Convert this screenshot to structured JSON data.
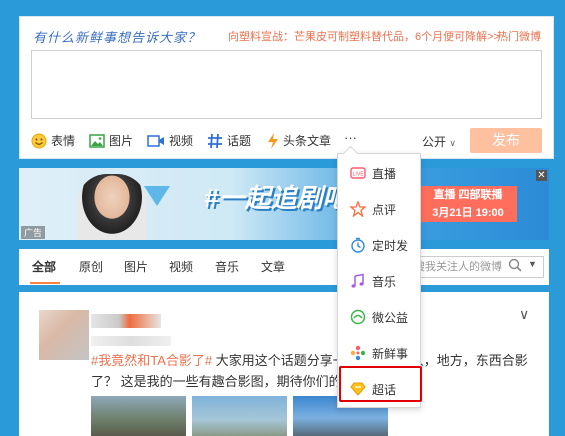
{
  "publisher": {
    "prompt": "有什么新鲜事想告诉大家？",
    "promo": "向塑料宣战：芒果皮可制塑料替代品，6个月便可降解>>",
    "hot_link": "热门微博",
    "textarea_value": "",
    "tools": [
      {
        "icon": "emoji-icon",
        "label": "表情"
      },
      {
        "icon": "image-icon",
        "label": "图片"
      },
      {
        "icon": "video-icon",
        "label": "视频"
      },
      {
        "icon": "hashtag-icon",
        "label": "话题"
      },
      {
        "icon": "lightning-icon",
        "label": "头条文章"
      },
      {
        "icon": "more-icon",
        "label": "···"
      }
    ],
    "visibility": "公开",
    "publish_label": "发布"
  },
  "banner": {
    "ad_label": "广告",
    "close": "✕",
    "slogan": "#一起追剧吧",
    "date_line1": "直播 四部联播",
    "date_line2": "3月21日 19:00"
  },
  "feed_tabs": {
    "tabs": [
      "全部",
      "原创",
      "图片",
      "视频",
      "音乐",
      "文章"
    ],
    "active_index": 0,
    "search_placeholder": "搜我关注人的微博"
  },
  "feed_post": {
    "tag": "#我竟然和TA合影了#",
    "text_line1": " 大家用这个话题分享一下自己和名人，地方，东西合影",
    "text_line2": "了？ 这是我的一些有趣合影图，期待你们的！"
  },
  "more_menu": {
    "items": [
      {
        "icon": "live-icon",
        "label": "直播"
      },
      {
        "icon": "review-icon",
        "label": "点评"
      },
      {
        "icon": "timer-icon",
        "label": "定时发"
      },
      {
        "icon": "music-icon",
        "label": "音乐"
      },
      {
        "icon": "charity-icon",
        "label": "微公益"
      },
      {
        "icon": "news-icon",
        "label": "新鲜事"
      },
      {
        "icon": "supertopic-icon",
        "label": "超话"
      }
    ],
    "highlighted_index": 6
  },
  "colors": {
    "accent": "#ff8140",
    "link": "#eb7350",
    "highlight_box": "#e00000",
    "background": "#2a9ad8"
  }
}
